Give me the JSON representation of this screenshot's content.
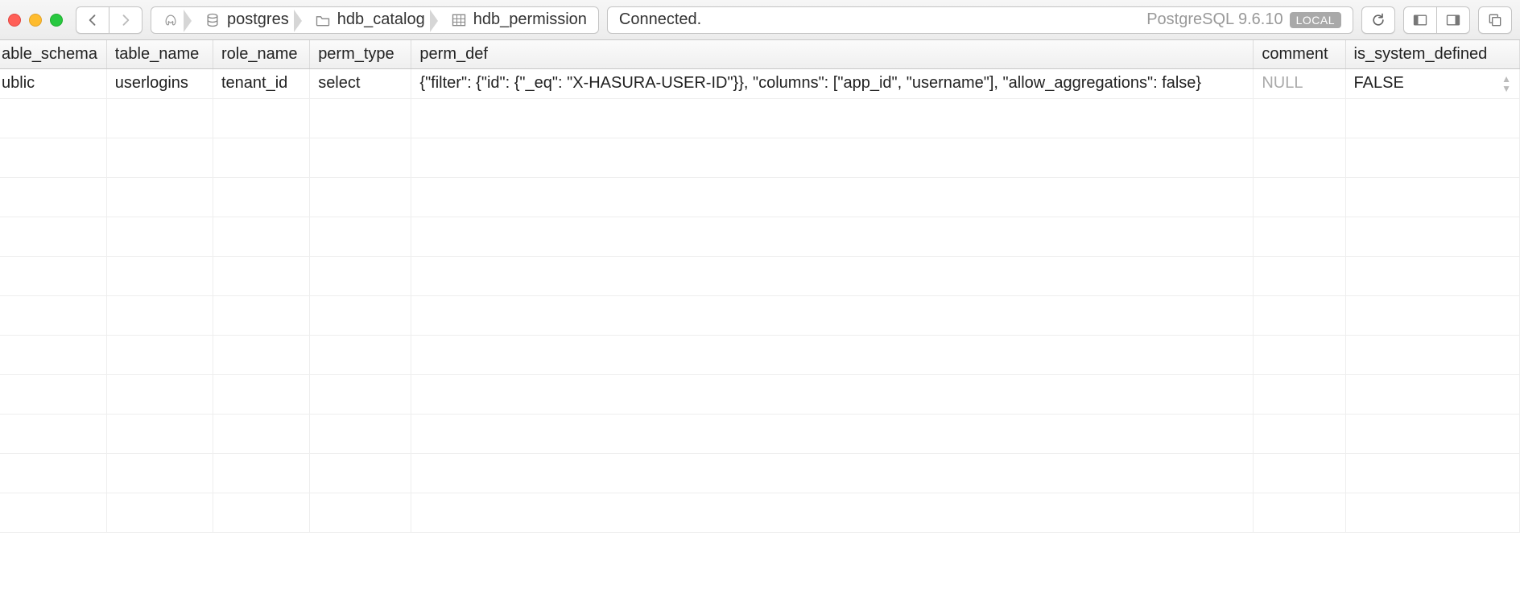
{
  "toolbar": {
    "breadcrumb": {
      "db": "postgres",
      "schema": "hdb_catalog",
      "table": "hdb_permission"
    },
    "status_left": "Connected.",
    "status_version": "PostgreSQL 9.6.10",
    "status_badge": "LOCAL"
  },
  "table": {
    "headers": {
      "col0": "able_schema",
      "col1": "table_name",
      "col2": "role_name",
      "col3": "perm_type",
      "col4": "perm_def",
      "col5": "comment",
      "col6": "is_system_defined"
    },
    "rows": [
      {
        "table_schema": "ublic",
        "table_name": "userlogins",
        "role_name": "tenant_id",
        "perm_type": "select",
        "perm_def": "{\"filter\": {\"id\": {\"_eq\": \"X-HASURA-USER-ID\"}}, \"columns\": [\"app_id\", \"username\"], \"allow_aggregations\": false}",
        "comment": "NULL",
        "is_system_defined": "FALSE"
      }
    ]
  }
}
